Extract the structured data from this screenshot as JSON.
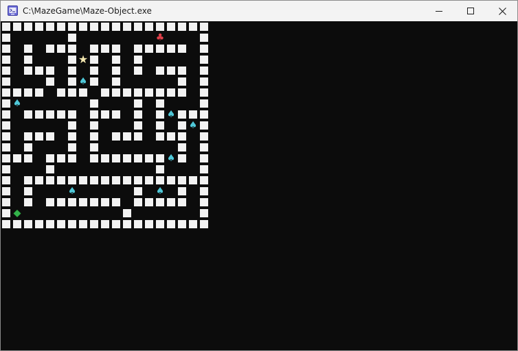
{
  "window": {
    "title": "C:\\MazeGame\\Maze-Object.exe",
    "icon": "console-app-icon",
    "controls": [
      {
        "name": "minimize-button",
        "icon": "minimize-icon"
      },
      {
        "name": "maximize-button",
        "icon": "maximize-icon"
      },
      {
        "name": "close-button",
        "icon": "close-icon"
      }
    ]
  },
  "colors": {
    "console_bg": "#0c0c0c",
    "wall": "#f2f2f2",
    "spade": "#4fc8d8",
    "club": "#e0404a",
    "star": "#f5e8b0",
    "diamond_fill": "#33b24a",
    "diamond_border": "#0a6a16"
  },
  "maze": {
    "cols": 19,
    "rows": 19,
    "grid": [
      "###################",
      "#.....#.......c...#",
      "#.#.###.###.#####.#",
      "#.#...#S#.#.#.....#",
      "#.###.#.#.#.#.###.#",
      "#...#.#p#.#.....#.#",
      "####.###.########.#",
      "#p......#...#.#...#",
      "#.#####.###.#.#p###",
      "#.....#.#...#.#.#p#",
      "#.###.#.#.###.###.#",
      "#.#...#.#.......#.#",
      "###.###.#######p#.#",
      "#...#.........#...#",
      "#.#################",
      "#.#...p.....#.p.#.#",
      "#.#.#######.#####.#",
      "#D.........#......#",
      "###################"
    ],
    "legend": {
      "#": "wall",
      ".": "path",
      "S": "star",
      "c": "club",
      "p": "spade",
      "D": "diamond"
    }
  },
  "symbols": {
    "star": "★",
    "club": "♣",
    "spade": "♠",
    "diamond": "◆"
  }
}
